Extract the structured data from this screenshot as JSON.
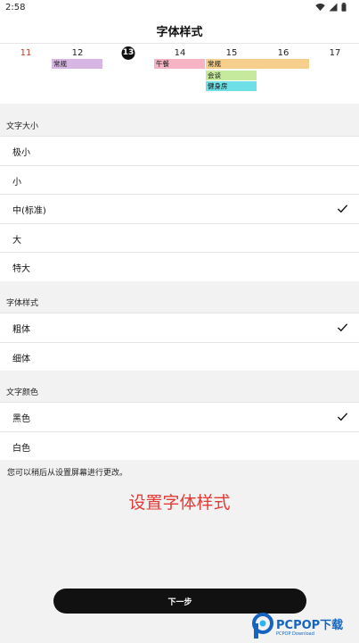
{
  "status_bar": {
    "time": "2:58"
  },
  "header": {
    "title": "字体样式"
  },
  "calendar": {
    "days": [
      {
        "label": "11",
        "kind": "sunday"
      },
      {
        "label": "12",
        "kind": "normal"
      },
      {
        "label": "13",
        "kind": "today"
      },
      {
        "label": "14",
        "kind": "normal"
      },
      {
        "label": "15",
        "kind": "normal"
      },
      {
        "label": "16",
        "kind": "normal"
      },
      {
        "label": "17",
        "kind": "normal"
      }
    ],
    "events": [
      {
        "label": "常规",
        "color": "#d7b6e3"
      },
      {
        "label": "午餐",
        "color": "#f5b3c4"
      },
      {
        "label": "常规",
        "color": "#f7cf8c"
      },
      {
        "label": "会谈",
        "color": "#c6ea9d"
      },
      {
        "label": "健身房",
        "color": "#6fe0e8"
      }
    ]
  },
  "sections": {
    "text_size": {
      "title": "文字大小",
      "options": [
        {
          "label": "极小",
          "selected": false
        },
        {
          "label": "小",
          "selected": false
        },
        {
          "label": "中(标准)",
          "selected": true
        },
        {
          "label": "大",
          "selected": false
        },
        {
          "label": "特大",
          "selected": false
        }
      ]
    },
    "font_style": {
      "title": "字体样式",
      "options": [
        {
          "label": "粗体",
          "selected": true
        },
        {
          "label": "细体",
          "selected": false
        }
      ]
    },
    "text_color": {
      "title": "文字颜色",
      "options": [
        {
          "label": "黑色",
          "selected": true
        },
        {
          "label": "白色",
          "selected": false
        }
      ]
    }
  },
  "footer_note": "您可以稍后从设置屏幕进行更改。",
  "overlay_caption": "设置字体样式",
  "next_button": "下一步",
  "watermark": {
    "brand": "PCPOP下载",
    "sub": "PCPOP Download"
  },
  "colors": {
    "accent_caption": "#e53935",
    "button_bg": "#111111",
    "watermark": "#1565c0"
  }
}
